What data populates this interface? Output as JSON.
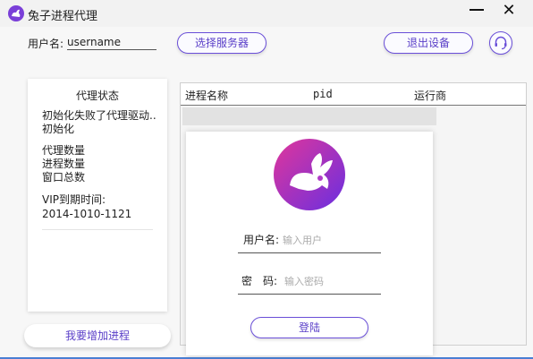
{
  "window": {
    "title": "兔子进程代理",
    "close_symbol": "✕"
  },
  "header": {
    "username_label": "用户名:",
    "username_value": "username",
    "select_server_label": "选择服务器",
    "logout_label": "退出设备"
  },
  "status": {
    "title": "代理状态",
    "line1": "初始化失败了代理驱动..",
    "line2": "初始化",
    "proxy_count_label": "代理数量",
    "process_count_label": "进程数量",
    "window_total_label": "窗口总数",
    "vip_expiry_label": "VIP到期时间:",
    "vip_expiry_value": "2014-1010-1121"
  },
  "add_process_label": "我要增加进程",
  "table": {
    "columns": [
      "进程名称",
      "pid",
      "运行商"
    ]
  },
  "login": {
    "username_label": "用户名:",
    "username_placeholder": "输入用户",
    "password_label": "密　码:",
    "password_placeholder": "输入密码",
    "submit_label": "登陆"
  },
  "colors": {
    "accent": "#5a3fc8",
    "logo_gradient_start": "#e0369b",
    "logo_gradient_end": "#6a2fe0"
  },
  "icons": {
    "app": "rabbit-icon",
    "support": "headset-icon"
  }
}
